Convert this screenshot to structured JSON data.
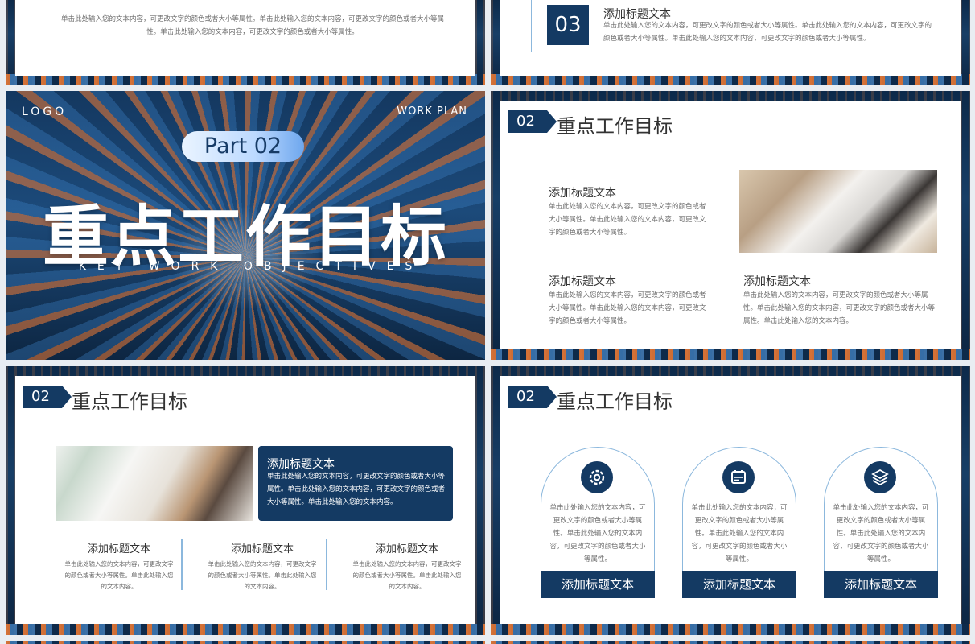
{
  "s1": {
    "text": "单击此处输入您的文本内容，可更改文字的颜色或者大小等属性。单击此处输入您的文本内容，可更改文字的颜色或者大小等属性。单击此处输入您的文本内容，可更改文字的颜色或者大小等属性。"
  },
  "s2": {
    "num": "03",
    "title": "添加标题文本",
    "text": "单击此处输入您的文本内容，可更改文字的颜色或者大小等属性。单击此处输入您的文本内容，可更改文字的颜色或者大小等属性。单击此处输入您的文本内容，可更改文字的颜色或者大小等属性。"
  },
  "cover": {
    "logo": "LOGO",
    "work_plan": "WORK PLAN",
    "part": "Part  02",
    "title": "重点工作目标",
    "subtitle": "KEY WORK OBJECTIVES"
  },
  "s4": {
    "num": "02",
    "title": "重点工作目标",
    "blocks": [
      {
        "title": "添加标题文本",
        "text": "单击此处输入您的文本内容，可更改文字的颜色或者大小等属性。单击此处输入您的文本内容，可更改文字的颜色或者大小等属性。"
      },
      {
        "title": "添加标题文本",
        "text": "单击此处输入您的文本内容，可更改文字的颜色或者大小等属性。单击此处输入您的文本内容，可更改文字的颜色或者大小等属性。"
      },
      {
        "title": "添加标题文本",
        "text": "单击此处输入您的文本内容，可更改文字的颜色或者大小等属性。单击此处输入您的文本内容，可更改文字的颜色或者大小等属性。单击此处输入您的文本内容。"
      }
    ]
  },
  "s5": {
    "num": "02",
    "title": "重点工作目标",
    "box_title": "添加标题文本",
    "box_text": "单击此处输入您的文本内容，可更改文字的颜色或者大小等属性。单击此处输入您的文本内容，可更改文字的颜色或者大小等属性。单击此处输入您的文本内容。",
    "cols": [
      {
        "title": "添加标题文本",
        "text": "单击此处输入您的文本内容，可更改文字的颜色或者大小等属性。单击此处输入您的文本内容。"
      },
      {
        "title": "添加标题文本",
        "text": "单击此处输入您的文本内容，可更改文字的颜色或者大小等属性。单击此处输入您的文本内容。"
      },
      {
        "title": "添加标题文本",
        "text": "单击此处输入您的文本内容，可更改文字的颜色或者大小等属性。单击此处输入您的文本内容。"
      }
    ]
  },
  "s6": {
    "num": "02",
    "title": "重点工作目标",
    "cards": [
      {
        "icon": "gear-icon",
        "text": "单击此处输入您的文本内容，可更改文字的颜色或者大小等属性。单击此处输入您的文本内容，可更改文字的颜色或者大小等属性。",
        "label": "添加标题文本"
      },
      {
        "icon": "calendar-icon",
        "text": "单击此处输入您的文本内容，可更改文字的颜色或者大小等属性。单击此处输入您的文本内容，可更改文字的颜色或者大小等属性。",
        "label": "添加标题文本"
      },
      {
        "icon": "layers-icon",
        "text": "单击此处输入您的文本内容，可更改文字的颜色或者大小等属性。单击此处输入您的文本内容，可更改文字的颜色或者大小等属性。",
        "label": "添加标题文本"
      }
    ]
  },
  "colors": {
    "navy": "#143a63",
    "accent_orange": "#f07b34",
    "line_blue": "#8cb8dd"
  }
}
